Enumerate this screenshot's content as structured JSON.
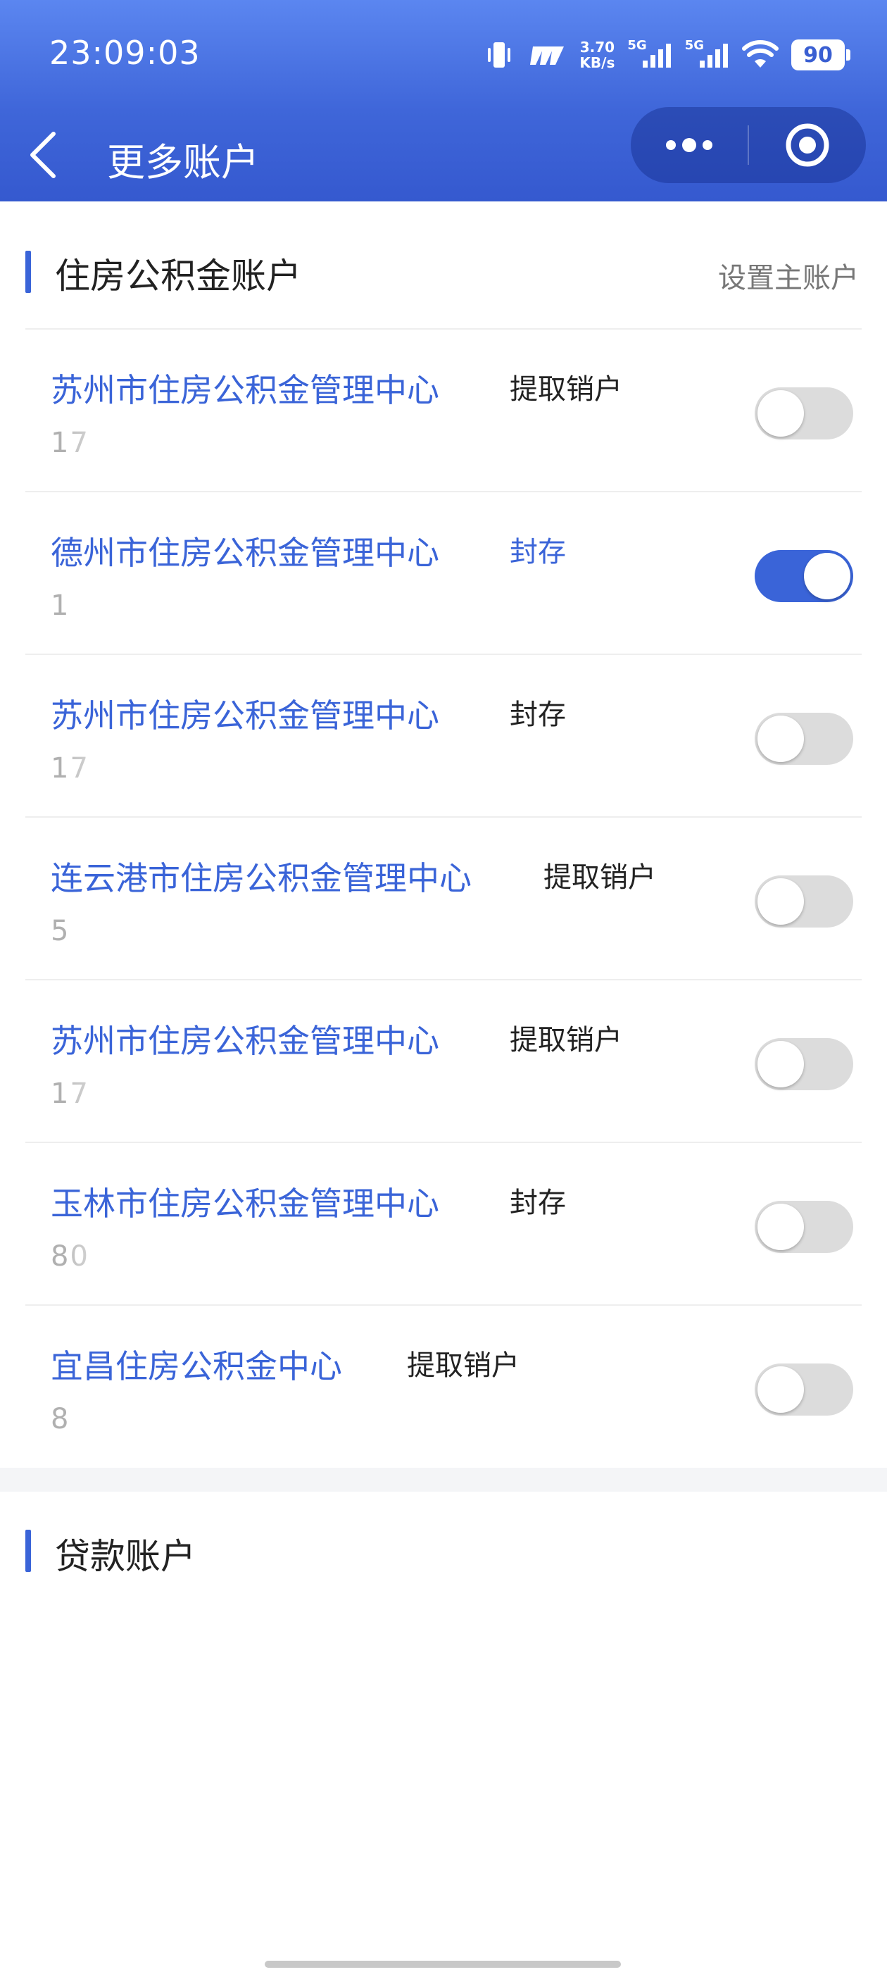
{
  "status_bar": {
    "time": "23:09:03",
    "speed_value": "3.70",
    "speed_unit": "KB/s",
    "net1": "5G",
    "net2": "5G",
    "battery": "90",
    "icons": [
      "vibrate-icon",
      "carrier-icon",
      "signal-icon",
      "signal-icon",
      "wifi-icon",
      "battery-icon"
    ]
  },
  "nav": {
    "title": "更多账户",
    "back_icon": "chevron-left-icon",
    "more_icon": "more-dots-icon",
    "target_icon": "target-icon"
  },
  "fund_section": {
    "title": "住房公积金账户",
    "action": "设置主账户",
    "accounts": [
      {
        "name": "苏州市住房公积金管理中心",
        "status": "提取销户",
        "number": "17",
        "primary": false
      },
      {
        "name": "德州市住房公积金管理中心",
        "status": "封存",
        "number": "1",
        "primary": true
      },
      {
        "name": "苏州市住房公积金管理中心",
        "status": "封存",
        "number": "17",
        "primary": false
      },
      {
        "name": "连云港市住房公积金管理中心",
        "status": "提取销户",
        "number": "5",
        "primary": false
      },
      {
        "name": "苏州市住房公积金管理中心",
        "status": "提取销户",
        "number": "17",
        "primary": false
      },
      {
        "name": "玉林市住房公积金管理中心",
        "status": "封存",
        "number": "80",
        "primary": false
      },
      {
        "name": "宜昌住房公积金中心",
        "status": "提取销户",
        "number": "8",
        "primary": false
      }
    ]
  },
  "loan_section": {
    "title": "贷款账户"
  },
  "colors": {
    "accent": "#3a64d8",
    "header_top": "#5b86f0",
    "header_bottom": "#3559cf"
  }
}
